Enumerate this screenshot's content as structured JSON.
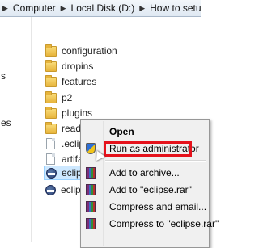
{
  "address_bar": {
    "crumbs": [
      "Computer",
      "Local Disk (D:)",
      "How to setup Selenium"
    ],
    "separator": "▶"
  },
  "nav": {
    "items": [
      "s",
      "es"
    ]
  },
  "files": [
    {
      "name": "configuration",
      "icon": "folder-icon"
    },
    {
      "name": "dropins",
      "icon": "folder-icon"
    },
    {
      "name": "features",
      "icon": "folder-icon"
    },
    {
      "name": "p2",
      "icon": "folder-icon"
    },
    {
      "name": "plugins",
      "icon": "folder-icon"
    },
    {
      "name": "readme",
      "icon": "folder-icon"
    },
    {
      "name": ".eclipseproduct",
      "icon": "document-icon"
    },
    {
      "name": "artifacts.xml",
      "icon": "document-icon"
    },
    {
      "name": "eclipse.exe",
      "icon": "eclipse-icon"
    },
    {
      "name": "eclipse.ini",
      "icon": "eclipse-icon"
    }
  ],
  "context_menu": {
    "items": [
      {
        "label": "Open",
        "bold": true,
        "icon": ""
      },
      {
        "label": "Run as administrator",
        "icon": "uac-shield-icon"
      },
      {
        "label": "Add to archive...",
        "icon": "winrar-icon"
      },
      {
        "label": "Add to \"eclipse.rar\"",
        "icon": "winrar-icon"
      },
      {
        "label": "Compress and email...",
        "icon": "winrar-icon"
      },
      {
        "label": "Compress to \"eclipse.rar\"",
        "icon": "winrar-icon"
      }
    ],
    "highlight_color": "#e5121c"
  }
}
